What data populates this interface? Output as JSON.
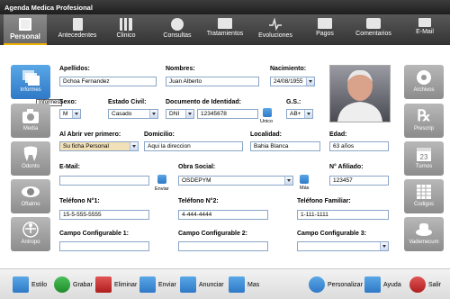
{
  "window": {
    "title": "Agenda Medica Profesional"
  },
  "nav": {
    "tabs": [
      {
        "label": "Personal",
        "icon": "person-card-icon"
      },
      {
        "label": "Antecedentes",
        "icon": "document-icon"
      },
      {
        "label": "Clinico",
        "icon": "chart-icon"
      },
      {
        "label": "Consultas",
        "icon": "chat-icon"
      },
      {
        "label": "Tratamientos",
        "icon": "monitor-icon"
      },
      {
        "label": "Evoluciones",
        "icon": "pulse-icon"
      },
      {
        "label": "Pagos",
        "icon": "money-icon"
      },
      {
        "label": "Comentarios",
        "icon": "comment-icon"
      },
      {
        "label": "E-Mail",
        "icon": "envelope-icon"
      }
    ]
  },
  "left_buttons": [
    {
      "label": "Informes",
      "icon": "documents-icon"
    },
    {
      "label": "Media",
      "icon": "camera-icon"
    },
    {
      "label": "Odonto",
      "icon": "tooth-icon"
    },
    {
      "label": "Oftalmo",
      "icon": "eye-icon"
    },
    {
      "label": "Antropo",
      "icon": "body-icon"
    }
  ],
  "tooltip": "Informes",
  "right_buttons": [
    {
      "label": "Archivos",
      "icon": "archive-icon"
    },
    {
      "label": "Prescrip",
      "icon": "rx-icon"
    },
    {
      "label": "Turnos",
      "icon": "calendar-icon"
    },
    {
      "label": "Codigos",
      "icon": "grid-icon"
    },
    {
      "label": "Vademecum",
      "icon": "pills-icon"
    }
  ],
  "form": {
    "apellidos": {
      "label": "Apellidos:",
      "value": "Dchoa Fernandez"
    },
    "nombres": {
      "label": "Nombres:",
      "value": "Juan Alberto"
    },
    "nacimiento": {
      "label": "Nacimiento:",
      "value": "24/08/1955"
    },
    "sexo": {
      "label": "Sexo:",
      "value": "M"
    },
    "estado_civil": {
      "label": "Estado Civil:",
      "value": "Casado"
    },
    "documento": {
      "label": "Documento de Identidad:",
      "type": "DNI",
      "number": "12345678",
      "button": "Unico"
    },
    "gs": {
      "label": "G.S.:",
      "value": "AB+"
    },
    "al_abrir": {
      "label": "Al Abrir ver primero:",
      "value": "Su ficha Personal"
    },
    "domicilio": {
      "label": "Domicilio:",
      "value": "Aqui la direccion"
    },
    "localidad": {
      "label": "Localidad:",
      "value": "Bahia Blanca"
    },
    "edad": {
      "label": "Edad:",
      "value": "63 años"
    },
    "email": {
      "label": "E-Mail:",
      "value": "",
      "button": "Enviar"
    },
    "obra_social": {
      "label": "Obra Social:",
      "value": "OSDEPYM",
      "button": "Más"
    },
    "afiliado": {
      "label": "N° Afiliado:",
      "value": "123457"
    },
    "telefono1": {
      "label": "Teléfono N°1:",
      "value": "15-5-555-5555"
    },
    "telefono2": {
      "label": "Teléfono N°2:",
      "value": "4-444-4444"
    },
    "telefono_familiar": {
      "label": "Teléfono Familiar:",
      "value": "1-111-1111"
    },
    "campo1": {
      "label": "Campo Configurable 1:",
      "value": ""
    },
    "campo2": {
      "label": "Campo Configurable 2:",
      "value": ""
    },
    "campo3": {
      "label": "Campo Configurable 3:",
      "value": ""
    }
  },
  "toolbar": {
    "estilo": "Estilo",
    "grabar": "Grabar",
    "eliminar": "Eliminar",
    "enviar": "Enviar",
    "anunciar": "Anunciar",
    "mas": "Mas",
    "personalizar": "Personalizar",
    "ayuda": "Ayuda",
    "salir": "Salir"
  },
  "colors": {
    "accent": "#f0b000",
    "blue": "#2f79c7",
    "field_border": "#8aa6c8"
  }
}
